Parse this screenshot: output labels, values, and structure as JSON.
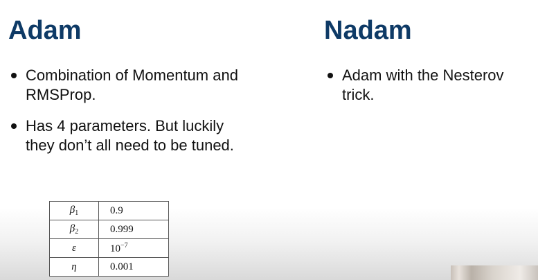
{
  "left": {
    "title": "Adam",
    "bullets": [
      "Combination of Momentum and RMSProp.",
      "Has 4 parameters. But luckily they don’t all need to be tuned."
    ],
    "params": [
      {
        "symbol": "β",
        "sub": "1",
        "value": "0.9"
      },
      {
        "symbol": "β",
        "sub": "2",
        "value": "0.999"
      },
      {
        "symbol": "ε",
        "value_base": "10",
        "value_exp": "−7"
      },
      {
        "symbol": "η",
        "value": "0.001"
      }
    ]
  },
  "right": {
    "title": "Nadam",
    "bullets": [
      "Adam with the Nesterov trick."
    ]
  },
  "colors": {
    "heading": "#0e3a66",
    "text": "#111111",
    "table_border": "#555555"
  }
}
